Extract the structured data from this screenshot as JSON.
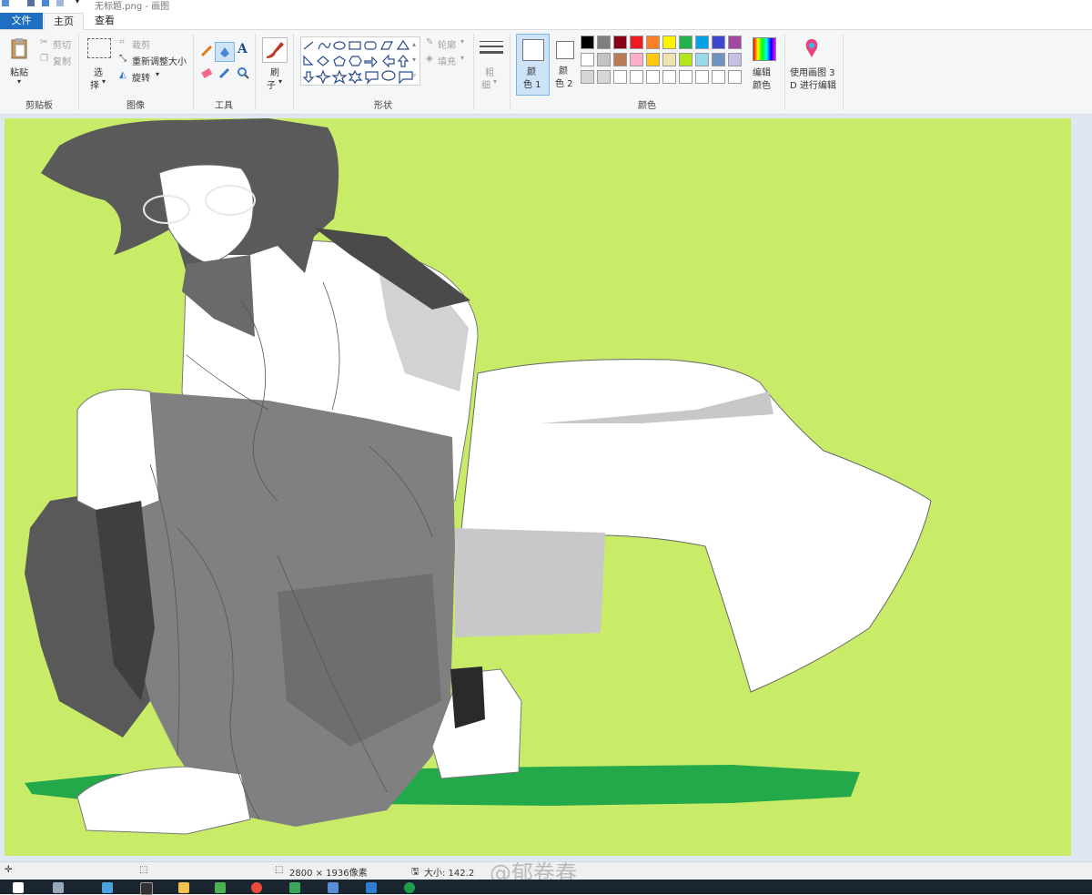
{
  "window": {
    "title": "无标题.png - 画图"
  },
  "tabs": {
    "file": "文件",
    "home": "主页",
    "view": "查看"
  },
  "clipboard": {
    "paste": "粘贴",
    "cut": "剪切",
    "copy": "复制",
    "group": "剪贴板"
  },
  "image": {
    "select_1": "选",
    "select_2": "择",
    "crop": "裁剪",
    "resize": "重新调整大小",
    "rotate": "旋转",
    "group": "图像"
  },
  "tools": {
    "group": "工具",
    "text_icon": "A"
  },
  "brushes": {
    "label_1": "刷",
    "label_2": "子"
  },
  "shapes": {
    "outline": "轮廓",
    "fill": "填充",
    "group": "形状"
  },
  "size": {
    "label_1": "粗",
    "label_2": "细"
  },
  "colors": {
    "color1_1": "颜",
    "color1_2": "色 1",
    "color2_1": "颜",
    "color2_2": "色 2",
    "edit_1": "编辑",
    "edit_2": "颜色",
    "group": "颜色",
    "palette_row1": [
      "#000000",
      "#7f7f7f",
      "#880015",
      "#ed1c24",
      "#ff7f27",
      "#fff200",
      "#22b14c",
      "#00a2e8",
      "#3f48cc",
      "#a349a4"
    ],
    "palette_row2": [
      "#ffffff",
      "#c3c3c3",
      "#b97a57",
      "#ffaec9",
      "#ffc90e",
      "#efe4b0",
      "#b5e61d",
      "#99d9ea",
      "#7092be",
      "#c8bfe7"
    ],
    "palette_row3": [
      "#d6d6d6",
      "#d6d6d6",
      "#ffffff",
      "#ffffff",
      "#ffffff",
      "#ffffff",
      "#ffffff",
      "#ffffff",
      "#ffffff",
      "#ffffff"
    ],
    "color1": "#ffffff",
    "color2": "#ffffff"
  },
  "paint3d": {
    "label_1": "使用画图 3",
    "label_2": "D 进行编辑"
  },
  "canvas": {
    "background": "#c9ec68"
  },
  "status": {
    "dimensions": "2800 × 1936像素",
    "size": "大小: 142.2",
    "watermark": "@郁卷春"
  }
}
